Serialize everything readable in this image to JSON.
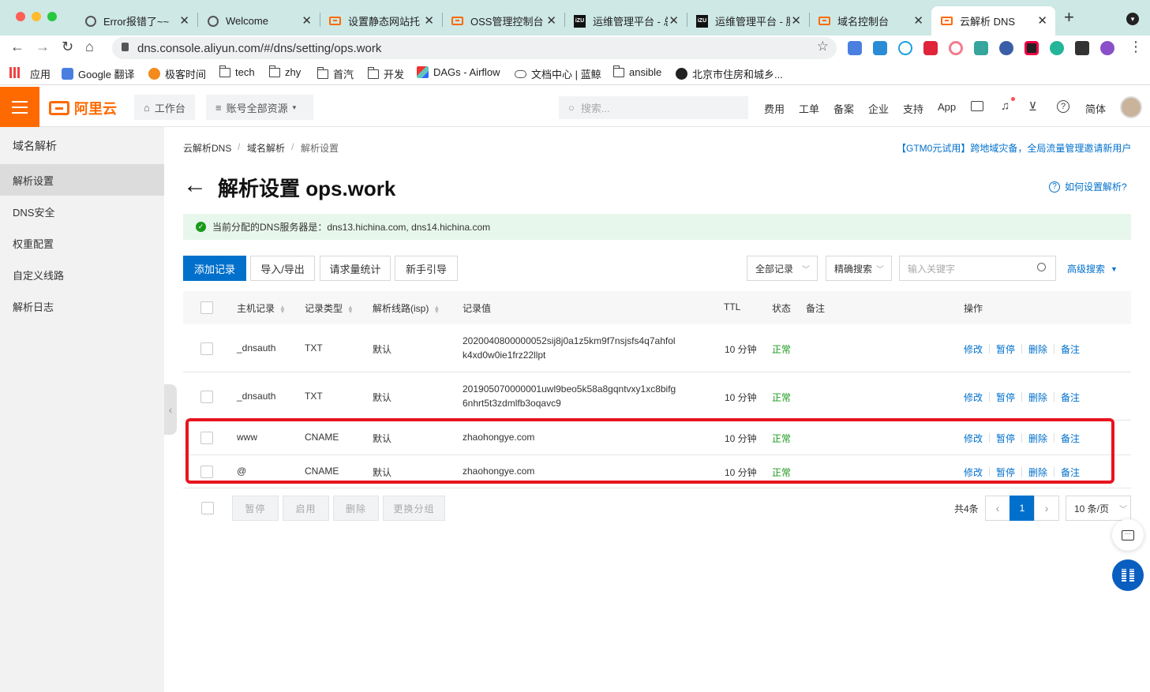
{
  "browser": {
    "tabs": [
      {
        "label": "Error报错了~~",
        "icon": "globe-icon"
      },
      {
        "label": "Welcome",
        "icon": "globe-icon"
      },
      {
        "label": "设置静态网站托管",
        "icon": "aliyun-icon"
      },
      {
        "label": "OSS管理控制台",
        "icon": "aliyun-icon"
      },
      {
        "label": "运维管理平台 - 总",
        "icon": "izu-icon"
      },
      {
        "label": "运维管理平台 - 服",
        "icon": "izu-icon"
      },
      {
        "label": "域名控制台",
        "icon": "aliyun-icon"
      },
      {
        "label": "云解析 DNS",
        "icon": "aliyun-icon"
      }
    ],
    "izu_text": "iZU",
    "url": "dns.console.aliyun.com/#/dns/setting/ops.work",
    "bookmarks": [
      "应用",
      "Google 翻译",
      "极客时间",
      "tech",
      "zhy",
      "首汽",
      "开发",
      "DAGs - Airflow",
      "文档中心 | 蓝鲸",
      "ansible",
      "北京市住房和城乡..."
    ]
  },
  "topnav": {
    "logo": "阿里云",
    "workbench": "工作台",
    "resources": "账号全部资源",
    "search_placeholder": "搜索...",
    "links": [
      "费用",
      "工单",
      "备案",
      "企业",
      "支持",
      "App"
    ],
    "lang": "简体"
  },
  "sidebar": {
    "title": "域名解析",
    "items": [
      "解析设置",
      "DNS安全",
      "权重配置",
      "自定义线路",
      "解析日志"
    ]
  },
  "breadcrumb": [
    "云解析DNS",
    "域名解析",
    "解析设置"
  ],
  "promo": "【GTM0元试用】跨地域灾备，全局流量管理邀请新用户",
  "page_title": "解析设置 ops.work",
  "help_link": "如何设置解析?",
  "dns_notice": "当前分配的DNS服务器是：dns13.hichina.com, dns14.hichina.com",
  "toolbar": {
    "add": "添加记录",
    "import_export": "导入/导出",
    "request_stats": "请求量统计",
    "guide": "新手引导",
    "filter_select": "全部记录",
    "search_mode": "精确搜索",
    "keyword_placeholder": "输入关键字",
    "advanced": "高级搜索"
  },
  "table": {
    "headers": [
      "主机记录",
      "记录类型",
      "解析线路(isp)",
      "记录值",
      "TTL",
      "状态",
      "备注",
      "操作"
    ],
    "actions": [
      "修改",
      "暂停",
      "删除",
      "备注"
    ],
    "rows": [
      {
        "host": "_dnsauth",
        "type": "TXT",
        "line": "默认",
        "value1": "2020040800000052sij8j0a1z5km9f7nsjsfs4q7ahfol",
        "value2": "k4xd0w0ie1frz22llpt",
        "ttl": "10 分钟",
        "status": "正常"
      },
      {
        "host": "_dnsauth",
        "type": "TXT",
        "line": "默认",
        "value1": "201905070000001uwl9beo5k58a8gqntvxy1xc8bifg",
        "value2": "6nhrt5t3zdmlfb3oqavc9",
        "ttl": "10 分钟",
        "status": "正常"
      },
      {
        "host": "www",
        "type": "CNAME",
        "line": "默认",
        "value1": "zhaohongye.com",
        "value2": "",
        "ttl": "10 分钟",
        "status": "正常"
      },
      {
        "host": "@",
        "type": "CNAME",
        "line": "默认",
        "value1": "zhaohongye.com",
        "value2": "",
        "ttl": "10 分钟",
        "status": "正常"
      }
    ]
  },
  "footer": {
    "bulk": [
      "暂停",
      "启用",
      "删除",
      "更换分组"
    ],
    "total": "共4条",
    "page": "1",
    "page_size": "10 条/页"
  },
  "colors": {
    "accent": "#ff6a00",
    "primary": "#0070cc",
    "ok": "#1a9a1a",
    "highlight": "#e8141f"
  }
}
